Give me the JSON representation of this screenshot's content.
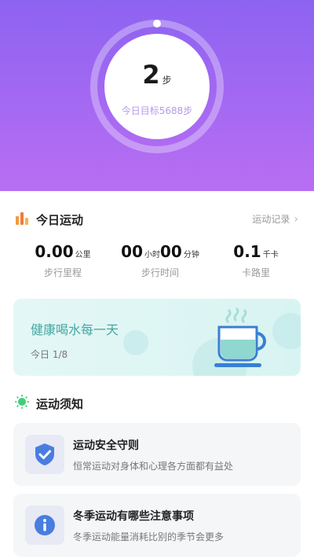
{
  "header": {
    "steps_value": "2",
    "steps_unit": "步",
    "goal_text": "今日目标5688步",
    "progress": 0.0004
  },
  "today": {
    "title": "今日运动",
    "record_link": "运动记录",
    "stats": [
      {
        "value": "0.00",
        "unit": "公里",
        "label": "步行里程"
      },
      {
        "value_hours": "00",
        "unit_hours": "小时",
        "value_minutes": "00",
        "unit_minutes": "分钟",
        "label": "步行时间"
      },
      {
        "value": "0.1",
        "unit": "千卡",
        "label": "卡路里"
      }
    ]
  },
  "water": {
    "title": "健康喝水每一天",
    "progress_text": "今日 1/8"
  },
  "notice": {
    "title": "运动须知",
    "items": [
      {
        "title": "运动安全守则",
        "desc": "恒常运动对身体和心理各方面都有益处",
        "icon": "shield-check-icon"
      },
      {
        "title": "冬季运动有哪些注意事项",
        "desc": "冬季运动能量消耗比别的季节会更多",
        "icon": "info-icon"
      }
    ]
  },
  "colors": {
    "hero_top": "#8d63f1",
    "hero_bottom": "#b86ef2",
    "water_accent": "#44a7a1"
  }
}
